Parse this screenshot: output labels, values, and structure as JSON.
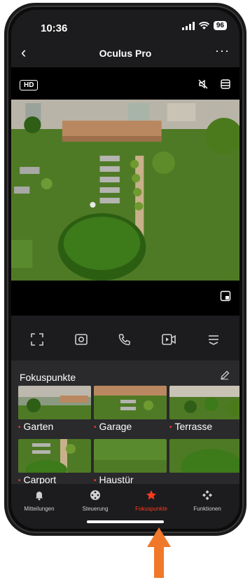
{
  "status": {
    "time": "10:36",
    "battery": "96"
  },
  "nav": {
    "title": "Oculus Pro",
    "back": "‹",
    "more": "···"
  },
  "video": {
    "badge": "HD"
  },
  "focus": {
    "title": "Fokuspunkte",
    "items": [
      {
        "label": "Garten"
      },
      {
        "label": "Garage"
      },
      {
        "label": "Terrasse"
      },
      {
        "label": "Carport"
      },
      {
        "label": "Haustür"
      },
      {
        "label": ""
      }
    ]
  },
  "tabs": [
    {
      "label": "Mitteilungen",
      "icon": "bell-icon"
    },
    {
      "label": "Steuerung",
      "icon": "joystick-icon"
    },
    {
      "label": "Fokuspunkte",
      "icon": "star-icon",
      "active": true
    },
    {
      "label": "Funktionen",
      "icon": "grid-icon"
    }
  ],
  "colors": {
    "accent": "#ff3b1f",
    "arrow": "#f0782a",
    "background": "#1c1c1e"
  }
}
